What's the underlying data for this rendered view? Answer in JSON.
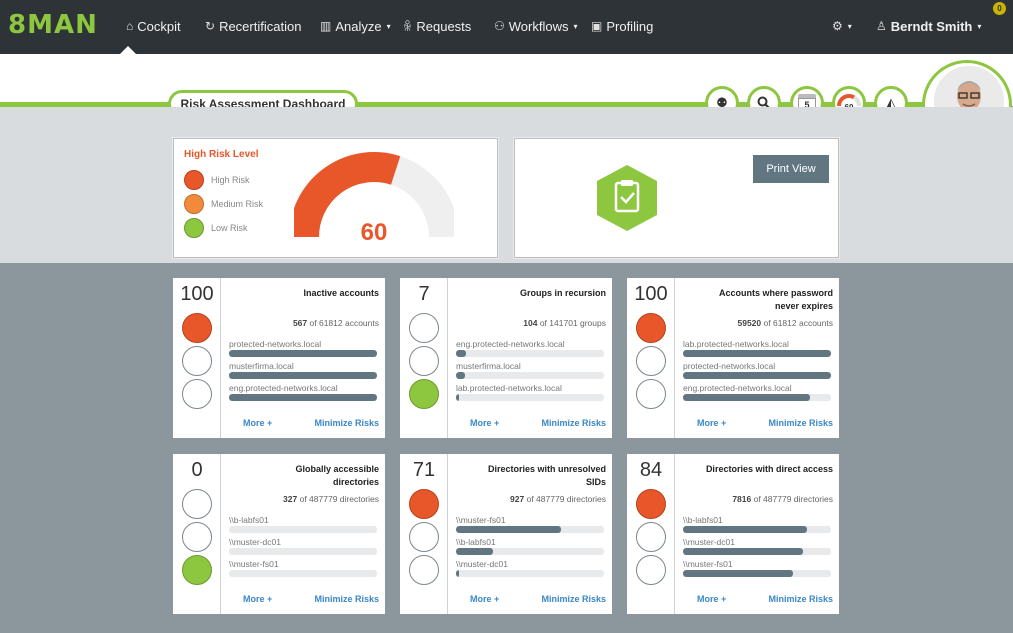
{
  "app": {
    "logo": "8MAN"
  },
  "nav": {
    "items": [
      {
        "label": "Cockpit",
        "icon": "home-icon"
      },
      {
        "label": "Recertification",
        "icon": "refresh-icon"
      },
      {
        "label": "Analyze",
        "icon": "bar-chart-icon"
      },
      {
        "label": "Requests",
        "icon": "users-icon"
      },
      {
        "label": "Workflows",
        "icon": "workflow-icon"
      },
      {
        "label": "Profiling",
        "icon": "id-card-icon"
      }
    ],
    "user": "Berndt Smith",
    "notification_count": "0"
  },
  "dashboard": {
    "title": "Risk Assessment Dashboard"
  },
  "toolbar": {
    "calendar_value": "5",
    "risk_value": "60"
  },
  "risk": {
    "title": "High Risk Level",
    "legend": [
      {
        "label": "High Risk",
        "color": "#e8572a"
      },
      {
        "label": "Medium Risk",
        "color": "#f28a3c"
      },
      {
        "label": "Low Risk",
        "color": "#8dc63f"
      }
    ],
    "value": "60",
    "gauge_fraction": 0.6
  },
  "print": {
    "label": "Print View"
  },
  "colors": {
    "accent": "#8dc63f",
    "high": "#e8572a",
    "bar": "#627682",
    "link": "#3a87c8"
  },
  "cards": [
    {
      "score": "100",
      "level": "red",
      "title": "Inactive accounts",
      "count": "567",
      "count_suffix": "of 61812 accounts",
      "rows": [
        {
          "label": "protected-networks.local",
          "fill": 1.0
        },
        {
          "label": "musterfirma.local",
          "fill": 1.0
        },
        {
          "label": "eng.protected-networks.local",
          "fill": 1.0
        }
      ],
      "more": "More +",
      "minimize": "Minimize Risks"
    },
    {
      "score": "7",
      "level": "green",
      "title": "Groups in recursion",
      "count": "104",
      "count_suffix": "of 141701 groups",
      "rows": [
        {
          "label": "eng.protected-networks.local",
          "fill": 0.07
        },
        {
          "label": "musterfirma.local",
          "fill": 0.06
        },
        {
          "label": "lab.protected-networks.local",
          "fill": 0.02
        }
      ],
      "more": "More +",
      "minimize": "Minimize Risks"
    },
    {
      "score": "100",
      "level": "red",
      "title": "Accounts where password never expires",
      "count": "59520",
      "count_suffix": "of 61812 accounts",
      "rows": [
        {
          "label": "lab.protected-networks.local",
          "fill": 1.0
        },
        {
          "label": "protected-networks.local",
          "fill": 1.0
        },
        {
          "label": "eng.protected-networks.local",
          "fill": 0.86
        }
      ],
      "more": "More +",
      "minimize": "Minimize Risks"
    },
    {
      "score": "0",
      "level": "green",
      "title": "Globally accessible directories",
      "count": "327",
      "count_suffix": "of 487779 directories",
      "rows": [
        {
          "label": "\\\\b-labfs01",
          "fill": 0.0
        },
        {
          "label": "\\\\muster-dc01",
          "fill": 0.0
        },
        {
          "label": "\\\\muster-fs01",
          "fill": 0.0
        }
      ],
      "more": "More +",
      "minimize": "Minimize Risks"
    },
    {
      "score": "71",
      "level": "red",
      "title": "Directories with unresolved SIDs",
      "count": "927",
      "count_suffix": "of 487779 directories",
      "rows": [
        {
          "label": "\\\\muster-fs01",
          "fill": 0.71
        },
        {
          "label": "\\\\b-labfs01",
          "fill": 0.25
        },
        {
          "label": "\\\\muster-dc01",
          "fill": 0.02
        }
      ],
      "more": "More +",
      "minimize": "Minimize Risks"
    },
    {
      "score": "84",
      "level": "red",
      "title": "Directories with direct access",
      "count": "7816",
      "count_suffix": "of 487779 directories",
      "rows": [
        {
          "label": "\\\\b-labfs01",
          "fill": 0.84
        },
        {
          "label": "\\\\muster-dc01",
          "fill": 0.81
        },
        {
          "label": "\\\\muster-fs01",
          "fill": 0.74
        }
      ],
      "more": "More +",
      "minimize": "Minimize Risks"
    }
  ]
}
